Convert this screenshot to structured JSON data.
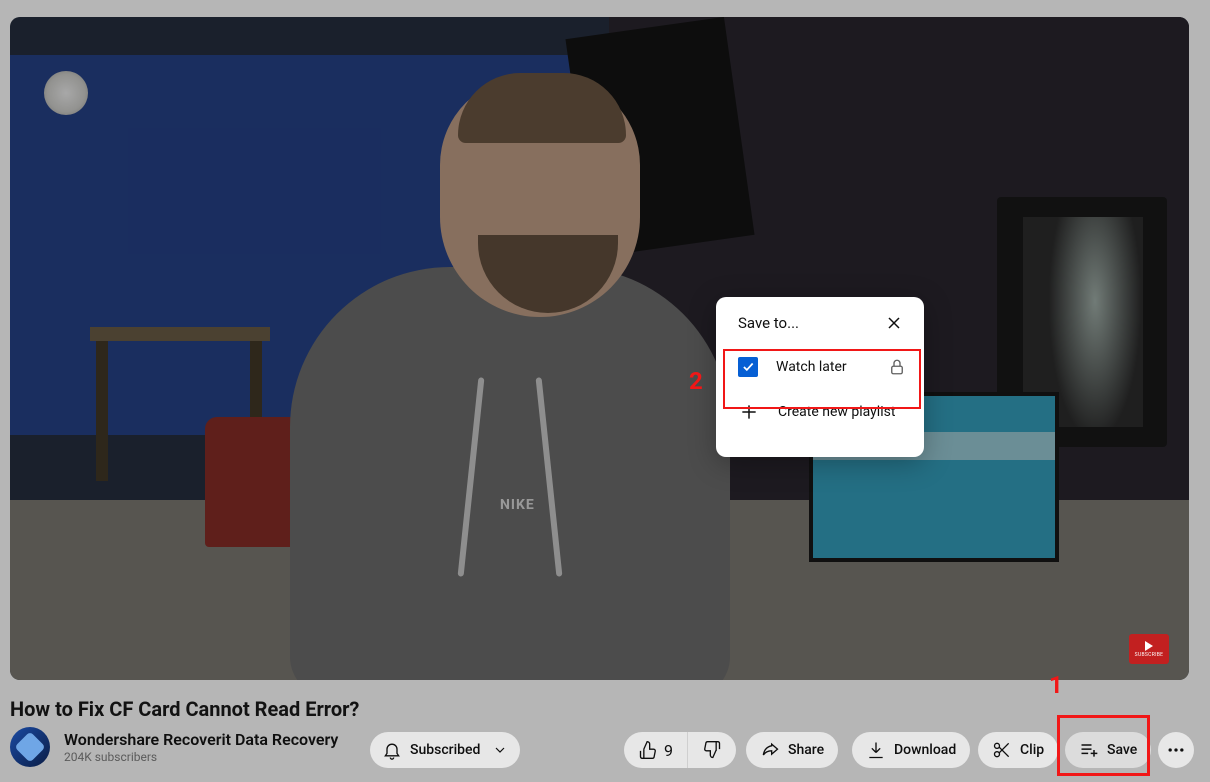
{
  "video": {
    "subscribe_badge": "SUBSCRIBE"
  },
  "title": "How to Fix CF Card Cannot Read Error?",
  "channel": {
    "name": "Wondershare Recoverit Data Recovery",
    "subscribers": "204K subscribers"
  },
  "actions": {
    "subscribed": "Subscribed",
    "likes": "9",
    "share": "Share",
    "download": "Download",
    "clip": "Clip",
    "save": "Save"
  },
  "popup": {
    "title": "Save to...",
    "watch_later": "Watch later",
    "create_playlist": "Create new playlist"
  },
  "annotations": {
    "one": "1",
    "two": "2"
  }
}
